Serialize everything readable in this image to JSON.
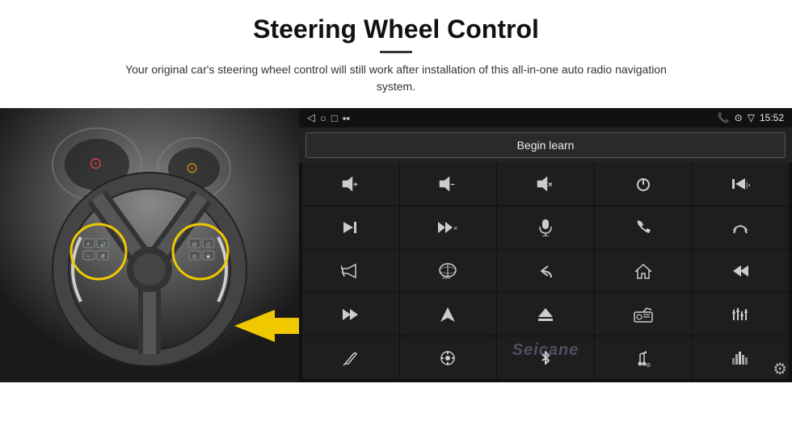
{
  "header": {
    "title": "Steering Wheel Control",
    "subtitle": "Your original car's steering wheel control will still work after installation of this all-in-one auto radio navigation system."
  },
  "android_panel": {
    "status_bar": {
      "back_icon": "◁",
      "circle_icon": "○",
      "square_icon": "□",
      "battery_icon": "▪▪",
      "phone_icon": "📞",
      "location_icon": "⊙",
      "wifi_icon": "▽",
      "time": "15:52"
    },
    "begin_learn_label": "Begin learn",
    "watermark": "Seicane",
    "grid_icons": [
      {
        "id": "vol-up",
        "symbol": "🔊+"
      },
      {
        "id": "vol-down",
        "symbol": "🔉−"
      },
      {
        "id": "mute",
        "symbol": "🔇"
      },
      {
        "id": "power",
        "symbol": "⏻"
      },
      {
        "id": "prev-track",
        "symbol": "⏮"
      },
      {
        "id": "next-skip",
        "symbol": "⏭"
      },
      {
        "id": "fwd-skip",
        "symbol": "⏩"
      },
      {
        "id": "mic",
        "symbol": "🎙"
      },
      {
        "id": "phone",
        "symbol": "📞"
      },
      {
        "id": "end-call",
        "symbol": "↷"
      },
      {
        "id": "horn",
        "symbol": "📣"
      },
      {
        "id": "view-360",
        "symbol": "⊛"
      },
      {
        "id": "back",
        "symbol": "↺"
      },
      {
        "id": "home",
        "symbol": "⌂"
      },
      {
        "id": "rewind",
        "symbol": "⏮"
      },
      {
        "id": "fast-fwd",
        "symbol": "⏭"
      },
      {
        "id": "navigate",
        "symbol": "▶"
      },
      {
        "id": "eject",
        "symbol": "⏏"
      },
      {
        "id": "radio",
        "symbol": "📻"
      },
      {
        "id": "equalizer",
        "symbol": "⊞"
      },
      {
        "id": "pen",
        "symbol": "✏"
      },
      {
        "id": "settings-dial",
        "symbol": "⊙"
      },
      {
        "id": "bluetooth",
        "symbol": "⚡"
      },
      {
        "id": "music",
        "symbol": "♪"
      },
      {
        "id": "bars",
        "symbol": "⫿"
      }
    ],
    "gear_icon": "⚙"
  }
}
